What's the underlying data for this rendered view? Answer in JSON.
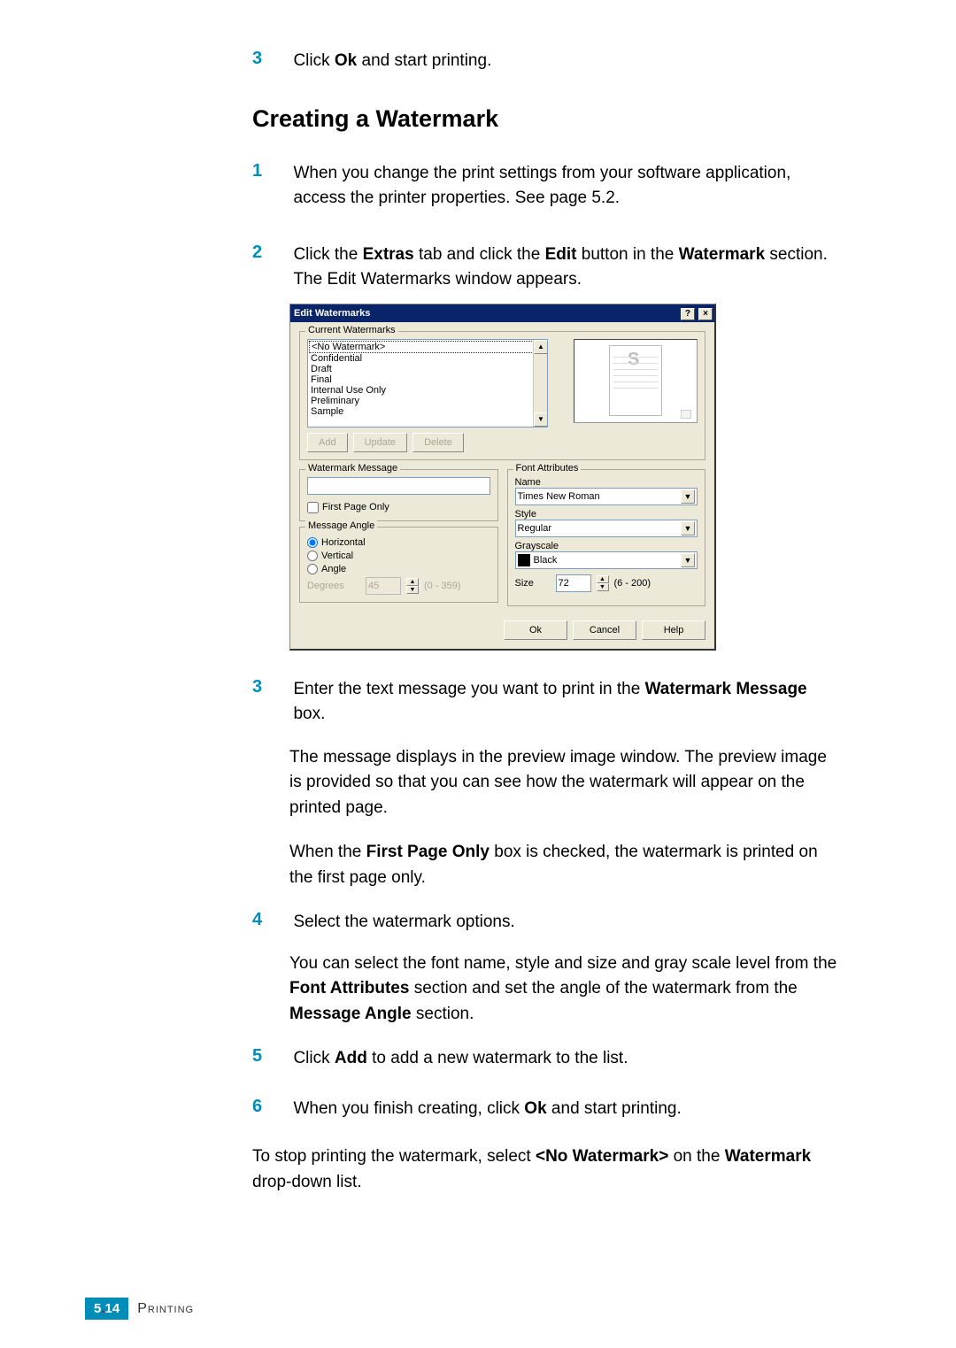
{
  "steps_top": {
    "s3": {
      "num": "3",
      "text_a": "Click ",
      "bold": "Ok",
      "text_b": " and start printing."
    }
  },
  "heading": "Creating a Watermark",
  "steps_heading_1": {
    "num": "1",
    "text": "When you change the print settings from your software application, access the printer properties. See page 5.2."
  },
  "steps_heading_2": {
    "num": "2",
    "text_a": "Click the ",
    "bold_a": "Extras",
    "text_b": " tab and click the ",
    "bold_b": "Edit",
    "text_c": " button in the ",
    "bold_c": "Watermark",
    "text_d": " section. The Edit Watermarks window appears."
  },
  "dialog": {
    "title": "Edit Watermarks",
    "help_btn": "?",
    "close_btn": "×",
    "gb_current": "Current Watermarks",
    "list_items": [
      "<No Watermark>",
      "Confidential",
      "Draft",
      "Final",
      "Internal Use Only",
      "Preliminary",
      "Sample"
    ],
    "btn_add": "Add",
    "btn_update": "Update",
    "btn_delete": "Delete",
    "gb_msg": "Watermark Message",
    "chk_firstpage": "First Page Only",
    "gb_angle": "Message Angle",
    "radio_h": "Horizontal",
    "radio_v": "Vertical",
    "radio_a": "Angle",
    "degrees_label": "Degrees",
    "degrees_value": "45",
    "degrees_range": "(0 - 359)",
    "gb_font": "Font Attributes",
    "name_label": "Name",
    "name_value": "Times New Roman",
    "style_label": "Style",
    "style_value": "Regular",
    "gray_label": "Grayscale",
    "gray_value": "Black",
    "size_label": "Size",
    "size_value": "72",
    "size_range": "(6 - 200)",
    "btn_ok": "Ok",
    "btn_cancel": "Cancel",
    "btn_help": "Help"
  },
  "steps_lower_3": {
    "num": "3",
    "text_a": "Enter the text message you want to print in the ",
    "bold": "Watermark Message",
    "text_b": " box."
  },
  "para_3a": "The message displays in the preview image window. The preview image is provided so that you can see how the watermark will appear on the printed page.",
  "para_3b_a": "When the ",
  "para_3b_bold": "First Page Only",
  "para_3b_b": " box is checked, the watermark is printed on the first page only.",
  "steps_lower_4": {
    "num": "4",
    "text": "Select the watermark options.",
    "para_a": "You can select the font name, style and size and gray scale level from the ",
    "bold_a": "Font Attributes",
    "para_b": " section and set the angle of the watermark from the ",
    "bold_b": "Message Angle",
    "para_c": " section."
  },
  "steps_lower_5": {
    "num": "5",
    "text_a": "Click ",
    "bold": "Add",
    "text_b": " to add a new watermark to the list."
  },
  "steps_lower_6": {
    "num": "6",
    "text_a": "When you finish creating, click ",
    "bold": "Ok",
    "text_b": " and start printing."
  },
  "para_stop_a": "To stop printing the watermark, select ",
  "para_stop_bold": "<No Watermark>",
  "para_stop_b": " on the ",
  "para_stop_bold2": "Watermark",
  "para_stop_c": " drop-down list.",
  "footer": {
    "page_a": "5",
    "page_b": "14",
    "section": "Printing"
  }
}
